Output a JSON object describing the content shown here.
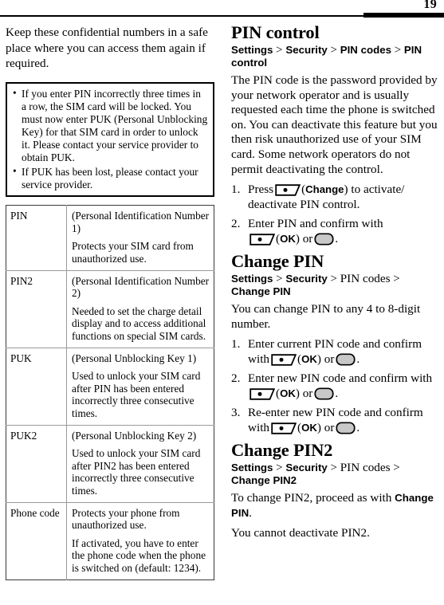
{
  "page": {
    "number": "19"
  },
  "left_column": {
    "intro_paragraph": "Keep these confidential numbers in a safe place where you can access them again if required.",
    "note_box": {
      "bullet_marker": "•",
      "items": [
        "If you enter PIN incorrectly three times in a row, the SIM card will be locked. You must now enter PUK (Personal Unblocking Key) for that SIM card in order to unlock it. Please contact your service provider to obtain PUK.",
        "If PUK has been lost, please contact your service provider."
      ]
    },
    "codes_table": {
      "rows": [
        {
          "name": "PIN",
          "paragraphs": [
            "(Personal Identification Number 1)",
            "Protects your SIM card from unauthorized use."
          ]
        },
        {
          "name": "PIN2",
          "paragraphs": [
            "(Personal Identification Number 2)",
            "Needed to set the charge detail display and to access additional functions on special SIM cards."
          ]
        },
        {
          "name": "PUK",
          "paragraphs": [
            "(Personal Unblocking Key 1)",
            "Used to unlock your SIM card after PIN has been entered incorrectly three consecutive times."
          ]
        },
        {
          "name": "PUK2",
          "paragraphs": [
            "(Personal Unblocking Key 2)",
            "Used to unlock your SIM card after PIN2 has been entered incorrectly three consecutive times."
          ]
        },
        {
          "name": "Phone code",
          "paragraphs": [
            "Protects your phone from unauthorized use.",
            "If activated, you have to enter the phone code when the phone is switched on (default: 1234)."
          ]
        }
      ]
    }
  },
  "right_column": {
    "sections": [
      {
        "id": "pin-control",
        "title": "PIN control",
        "breadcrumb": {
          "crumb1": "Settings",
          "crumb2": "Security",
          "crumb3": "PIN codes",
          "crumb4": "PIN control",
          "separator": ">"
        },
        "body": "The PIN code is the password provided by your network operator and is usually requested each time the phone is switched on. You can deactivate this feature but you then risk unauthorized use of your SIM card. Some network operators do not permit deactivating the control.",
        "steps": [
          {
            "number": "1.",
            "text_before": "Press",
            "key1_label": "Change",
            "text_after": "to activate/ deactivate PIN control."
          },
          {
            "number": "2.",
            "text_before": "Enter PIN and confirm with",
            "key1_label": "OK",
            "text_middle": "or",
            "text_after": "."
          }
        ]
      },
      {
        "id": "change-pin",
        "title": "Change PIN",
        "breadcrumb": {
          "crumb1": "Settings",
          "crumb2": "Security",
          "crumb3": "PIN codes",
          "crumb4": "Change PIN",
          "separator": ">"
        },
        "body": "You can change PIN to any 4 to 8-digit number.",
        "steps": [
          {
            "number": "1.",
            "text_before": "Enter current PIN code and confirm with",
            "key1_label": "OK",
            "text_middle": "or",
            "text_after": "."
          },
          {
            "number": "2.",
            "text_before": "Enter new PIN code and confirm with",
            "key1_label": "OK",
            "text_middle": "or",
            "text_after": "."
          },
          {
            "number": "3.",
            "text_before": "Re-enter new PIN code and confirm with",
            "key1_label": "OK",
            "text_middle": "or",
            "text_after": "."
          }
        ]
      },
      {
        "id": "change-pin2",
        "title": "Change PIN2",
        "breadcrumb": {
          "crumb1": "Settings",
          "crumb2": "Security",
          "crumb3": "PIN codes",
          "crumb4": "Change PIN2",
          "separator": ">"
        },
        "body_before": "To change PIN2, proceed as with",
        "body_emphasis": "Change PIN",
        "body_after": ".",
        "closing": "You cannot deactivate PIN2."
      }
    ]
  },
  "icons": {
    "soft_key": "soft-key-icon",
    "round_key": "round-key-icon"
  },
  "colors": {
    "text": "#000000",
    "table_border_outer": "#3a3a3a",
    "table_border_inner": "#9a9a9a",
    "key_fill": "#c8c8c8",
    "page_background": "#ffffff"
  }
}
